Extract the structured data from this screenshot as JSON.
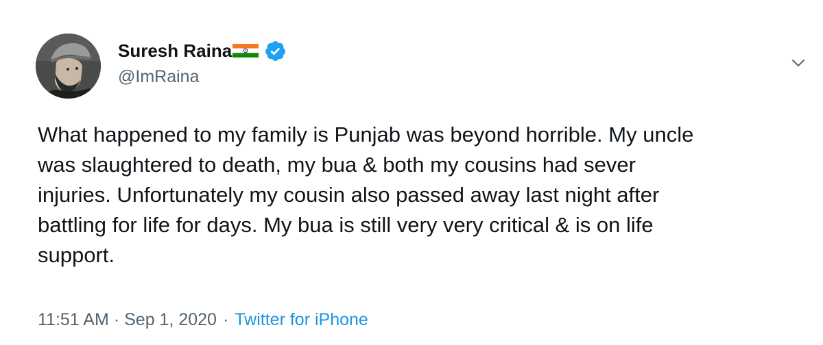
{
  "author": {
    "display_name": "Suresh Raina",
    "handle": "@ImRaina",
    "avatar_icon": "profile-photo-avatar",
    "flag_icon": "india-flag-icon",
    "verified_icon": "verified-badge-icon",
    "verified_color": "#1da1f2"
  },
  "tweet": {
    "text": "What happened to my family is Punjab was beyond horrible. My uncle\nwas slaughtered to death, my bua & both my cousins had sever\ninjuries. Unfortunately my cousin also passed away last night after\nbattling for life for days. My bua is still very very critical & is on life\nsupport.",
    "time": "11:51 AM",
    "separator": "·",
    "date": "Sep 1, 2020",
    "source": "Twitter for iPhone",
    "source_color": "#1b95e0"
  },
  "menu": {
    "caret_icon": "chevron-down-icon"
  }
}
